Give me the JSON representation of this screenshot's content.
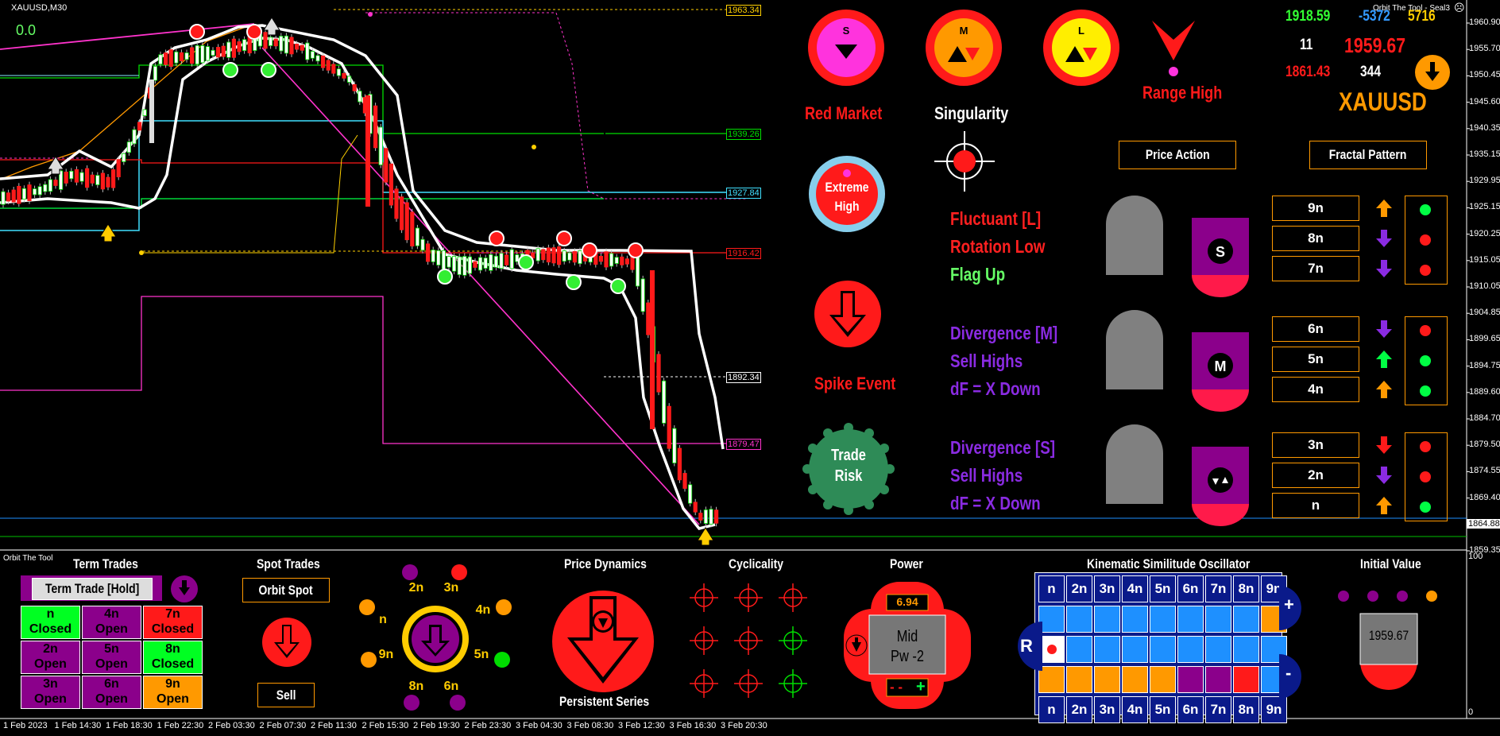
{
  "window": {
    "symbol_title": "XAUUSD,M30",
    "indicator_title": "Orbit The Tool - Seal3",
    "zero_value": "0.0"
  },
  "price_axis": [
    "1960.90",
    "1955.70",
    "1950.45",
    "1945.60",
    "1940.35",
    "1935.15",
    "1929.95",
    "1925.15",
    "1920.25",
    "1915.05",
    "1910.05",
    "1904.85",
    "1899.65",
    "1894.75",
    "1889.60",
    "1884.70",
    "1879.50",
    "1874.55",
    "1869.40",
    "1864.88",
    "1859.35"
  ],
  "osc_axis": {
    "top": "100",
    "bottom": "0"
  },
  "time_axis": [
    "1 Feb 2023",
    "1 Feb 14:30",
    "1 Feb 18:30",
    "1 Feb 22:30",
    "2 Feb 03:30",
    "2 Feb 07:30",
    "2 Feb 11:30",
    "2 Feb 15:30",
    "2 Feb 19:30",
    "2 Feb 23:30",
    "3 Feb 04:30",
    "3 Feb 08:30",
    "3 Feb 12:30",
    "3 Feb 16:30",
    "3 Feb 20:30"
  ],
  "level_tags": [
    {
      "text": "1963.34",
      "color": "#ffd000"
    },
    {
      "text": "1939.26",
      "color": "#00e000"
    },
    {
      "text": "1927.84",
      "color": "#40e0ff"
    },
    {
      "text": "1916.42",
      "color": "#ff1a1a"
    },
    {
      "text": "1892.34",
      "color": "#ffffff"
    },
    {
      "text": "1879.47",
      "color": "#ff33cc"
    }
  ],
  "stats": {
    "v1": "1918.59",
    "v2": "-5372",
    "v3": "5716",
    "v4": "11",
    "v5": "1959.67",
    "v6": "1861.43",
    "v7": "344",
    "symbol": "XAUUSD"
  },
  "orbs": {
    "s": "S",
    "m": "M",
    "l": "L"
  },
  "labels": {
    "red_market": "Red Market",
    "singularity": "Singularity",
    "range_high": "Range High",
    "extreme_high_1": "Extreme",
    "extreme_high_2": "High",
    "spike_event": "Spike Event",
    "trade_risk_1": "Trade",
    "trade_risk_2": "Risk",
    "price_action": "Price Action",
    "fractal_pattern": "Fractal Pattern"
  },
  "signals": [
    {
      "line1": "Fluctuant [L]",
      "line2": "Rotation Low",
      "line3": "Flag Up",
      "colors": [
        "#ff2020",
        "#ff2020",
        "#66ff66"
      ]
    },
    {
      "line1": "Divergence [M]",
      "line2": "Sell Highs",
      "line3": "dF = X Down",
      "colors": [
        "#8a2be2",
        "#8a2be2",
        "#8a2be2"
      ]
    },
    {
      "line1": "Divergence [S]",
      "line2": "Sell Highs",
      "line3": "dF = X Down",
      "colors": [
        "#8a2be2",
        "#8a2be2",
        "#8a2be2"
      ]
    }
  ],
  "fractals": {
    "s": "S",
    "m": "M"
  },
  "ladder": [
    "9n",
    "8n",
    "7n",
    "6n",
    "5n",
    "4n",
    "3n",
    "2n",
    "n"
  ],
  "ladder_arrows": [
    {
      "dir": "up",
      "color": "#ff9900"
    },
    {
      "dir": "down",
      "color": "#8a2be2"
    },
    {
      "dir": "down",
      "color": "#8a2be2"
    },
    {
      "dir": "down",
      "color": "#8a2be2"
    },
    {
      "dir": "up",
      "color": "#00ff44"
    },
    {
      "dir": "up",
      "color": "#ff9900"
    },
    {
      "dir": "down",
      "color": "#ff1a1a"
    },
    {
      "dir": "down",
      "color": "#8a2be2"
    },
    {
      "dir": "up",
      "color": "#ff9900"
    }
  ],
  "ladder_dots": [
    "#00ff44",
    "#ff1a1a",
    "#ff1a1a",
    "#ff1a1a",
    "#00ff44",
    "#00ff44",
    "#ff1a1a",
    "#ff1a1a",
    "#00ff44"
  ],
  "panel": {
    "title": "Orbit The Tool",
    "term_trades": "Term Trades",
    "term_trade_hold": "Term Trade [Hold]",
    "term_cells": [
      {
        "n": "n",
        "s": "Closed",
        "bg": "#00ff22"
      },
      {
        "n": "4n",
        "s": "Open",
        "bg": "#8b008b"
      },
      {
        "n": "7n",
        "s": "Closed",
        "bg": "#ff1a1a"
      },
      {
        "n": "2n",
        "s": "Open",
        "bg": "#8b008b"
      },
      {
        "n": "5n",
        "s": "Open",
        "bg": "#8b008b"
      },
      {
        "n": "8n",
        "s": "Closed",
        "bg": "#00ff22"
      },
      {
        "n": "3n",
        "s": "Open",
        "bg": "#8b008b"
      },
      {
        "n": "6n",
        "s": "Open",
        "bg": "#8b008b"
      },
      {
        "n": "9n",
        "s": "Open",
        "bg": "#ff9900"
      }
    ],
    "spot_trades": "Spot Trades",
    "orbit_spot": "Orbit Spot",
    "sell": "Sell",
    "ring_labels": [
      "2n",
      "3n",
      "4n",
      "5n",
      "6n",
      "8n",
      "9n",
      "n"
    ],
    "price_dynamics": "Price Dynamics",
    "persistent_series": "Persistent Series",
    "cyclicality": "Cyclicality",
    "power": "Power",
    "power_value": "6.94",
    "power_mid": "Mid",
    "power_pw": "Pw -2",
    "power_minus": "- - ",
    "power_plus": "+",
    "kso": "Kinematic Similitude Oscillator",
    "kso_header": [
      "n",
      "2n",
      "3n",
      "4n",
      "5n",
      "6n",
      "7n",
      "8n",
      "9n"
    ],
    "kso_rows": [
      [
        "#1e90ff",
        "#1e90ff",
        "#1e90ff",
        "#1e90ff",
        "#1e90ff",
        "#1e90ff",
        "#1e90ff",
        "#1e90ff",
        "#ff9900"
      ],
      [
        "#ffffff",
        "#1e90ff",
        "#1e90ff",
        "#1e90ff",
        "#1e90ff",
        "#1e90ff",
        "#1e90ff",
        "#1e90ff",
        "#1e90ff"
      ],
      [
        "#ff9900",
        "#ff9900",
        "#ff9900",
        "#ff9900",
        "#ff9900",
        "#8b008b",
        "#8b008b",
        "#ff1a1a",
        "#1e90ff"
      ]
    ],
    "kso_r": "R",
    "kso_plus": "+",
    "kso_minus": "-",
    "initial_value": "Initial Value",
    "initial_value_num": "1959.67"
  }
}
